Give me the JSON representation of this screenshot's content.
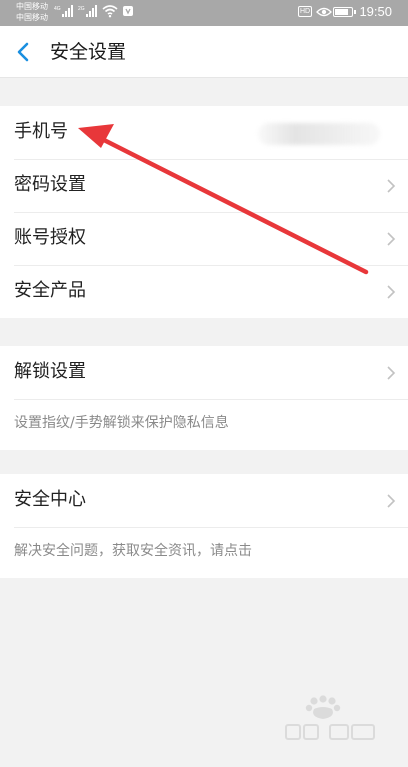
{
  "status_bar": {
    "carrier_1": "中国移动",
    "carrier_2": "中国移动",
    "signal_label_1": "4G",
    "signal_label_2": "2G",
    "hd_badge": "HD",
    "time": "19:50",
    "battery_level": 0.8
  },
  "header": {
    "title": "安全设置"
  },
  "group_1": {
    "items": [
      {
        "label": "手机号"
      },
      {
        "label": "密码设置"
      },
      {
        "label": "账号授权"
      },
      {
        "label": "安全产品"
      }
    ]
  },
  "group_2": {
    "item_label": "解锁设置",
    "hint": "设置指纹/手势解锁来保护隐私信息"
  },
  "group_3": {
    "item_label": "安全中心",
    "hint": "解决安全问题，获取安全资讯，请点击"
  },
  "colors": {
    "accent": "#1a8fe0",
    "annotation_arrow": "#e8373a",
    "background": "#f2f2f2",
    "status_bar": "#a8a8a8"
  }
}
